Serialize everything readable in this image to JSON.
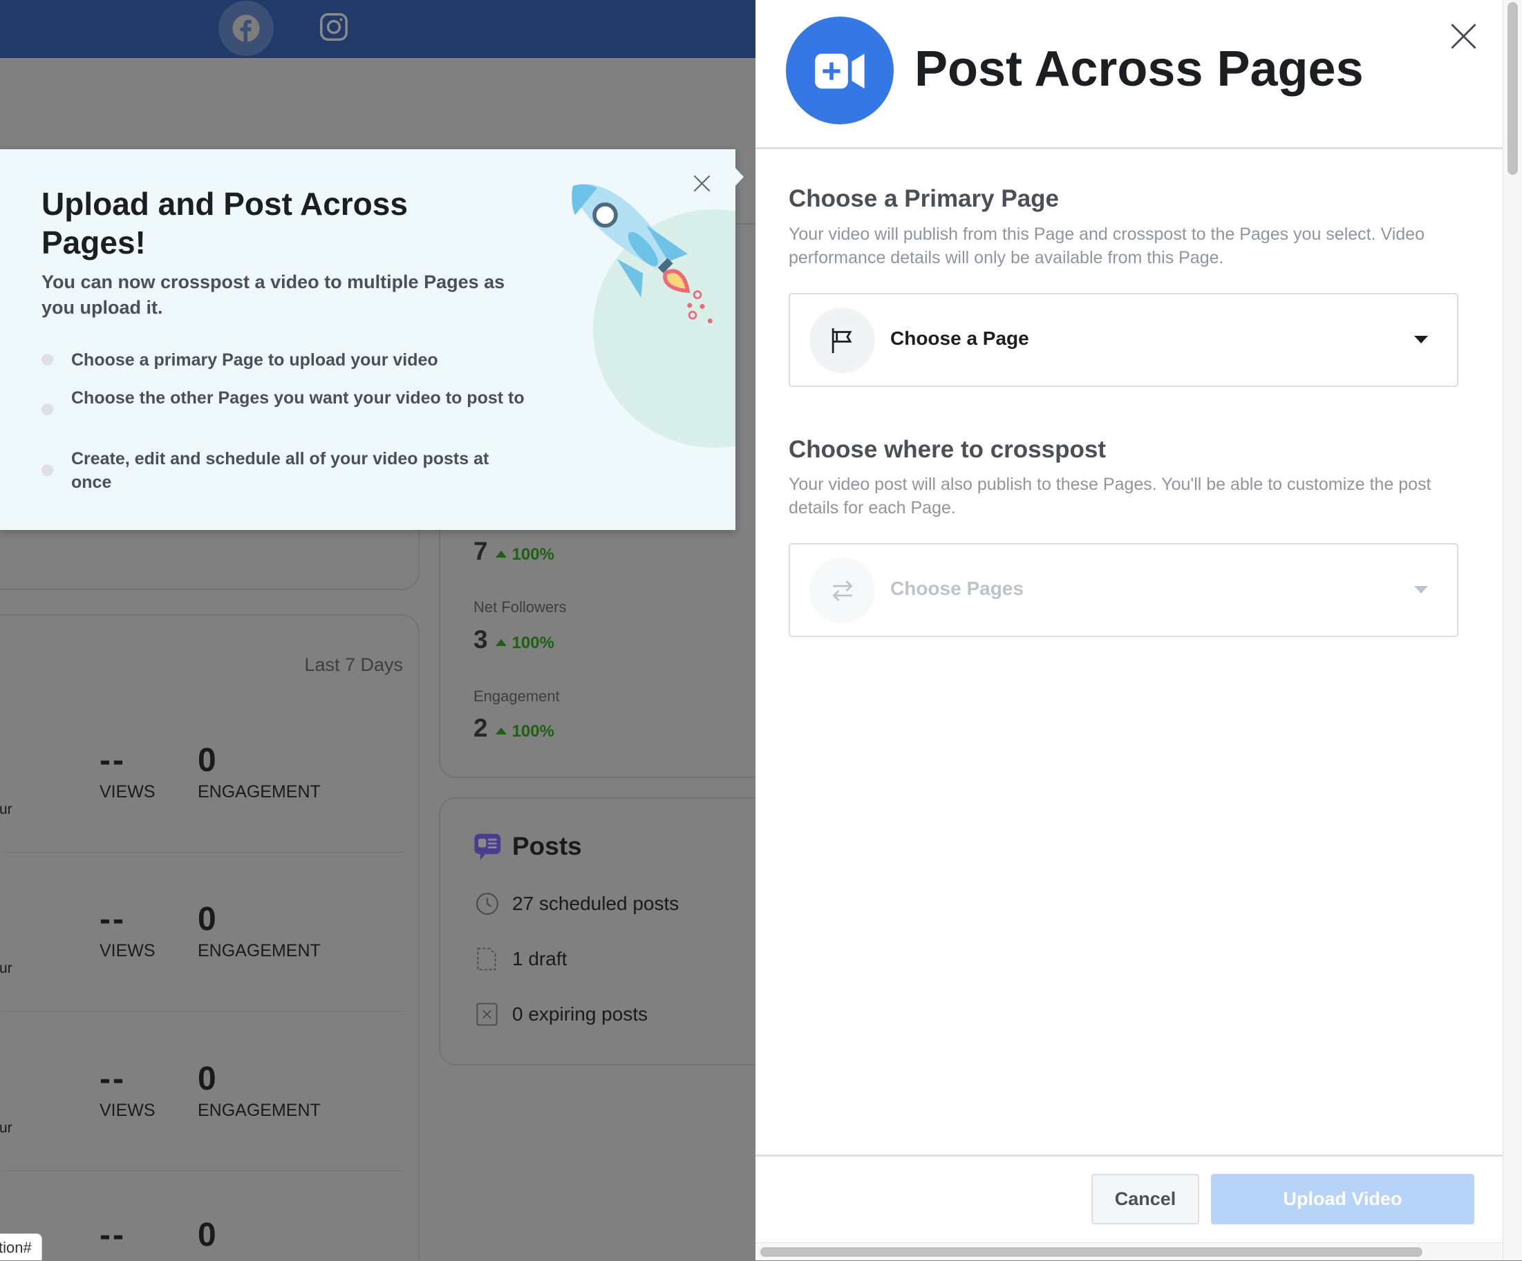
{
  "background": {
    "social_tabs": [
      {
        "icon": "facebook-icon",
        "active": true
      },
      {
        "icon": "instagram-icon",
        "active": false
      }
    ],
    "stats": [
      {
        "label": "",
        "value": "7",
        "change": "100%"
      },
      {
        "label": "Net Followers",
        "value": "3",
        "change": "100%"
      },
      {
        "label": "Engagement",
        "value": "2",
        "change": "100%"
      }
    ],
    "period": "Last 7 Days",
    "video_rows": [
      {
        "views": "--",
        "views_label": "VIEWS",
        "engagement": "0",
        "engagement_label": "ENGAGEMENT",
        "fragment": "ur"
      },
      {
        "views": "--",
        "views_label": "VIEWS",
        "engagement": "0",
        "engagement_label": "ENGAGEMENT",
        "fragment": "ur"
      },
      {
        "views": "--",
        "views_label": "VIEWS",
        "engagement": "0",
        "engagement_label": "ENGAGEMENT",
        "fragment": "ur"
      },
      {
        "views": "--",
        "engagement": "0"
      }
    ],
    "posts": {
      "title": "Posts",
      "items": [
        {
          "icon": "clock-icon",
          "text": "27 scheduled posts"
        },
        {
          "icon": "draft-icon",
          "text": "1 draft"
        },
        {
          "icon": "expiring-icon",
          "text": "0 expiring posts"
        }
      ]
    },
    "status_url": "tion#",
    "colors": {
      "header": "#223a6a",
      "positive": "#1f5f12",
      "posts_icon": "#4a3d8f"
    }
  },
  "popup": {
    "title": "Upload and Post Across Pages!",
    "subtitle": "You can now crosspost a video to multiple Pages as you upload it.",
    "bullets": [
      "Choose a primary Page to upload your video",
      "Choose the other Pages you want your video to post to",
      "Create, edit and schedule all of your video posts at once"
    ]
  },
  "panel": {
    "title": "Post Across Pages",
    "accent": "#3578e5",
    "primary": {
      "heading": "Choose a Primary Page",
      "description": "Your video will publish from this Page and crosspost to the Pages you select. Video performance details will only be available from this Page.",
      "select_label": "Choose a Page"
    },
    "crosspost": {
      "heading": "Choose where to crosspost",
      "description": "Your video post will also publish to these Pages. You'll be able to customize the post details for each Page.",
      "select_label": "Choose Pages"
    },
    "cancel_label": "Cancel",
    "upload_label": "Upload Video"
  }
}
